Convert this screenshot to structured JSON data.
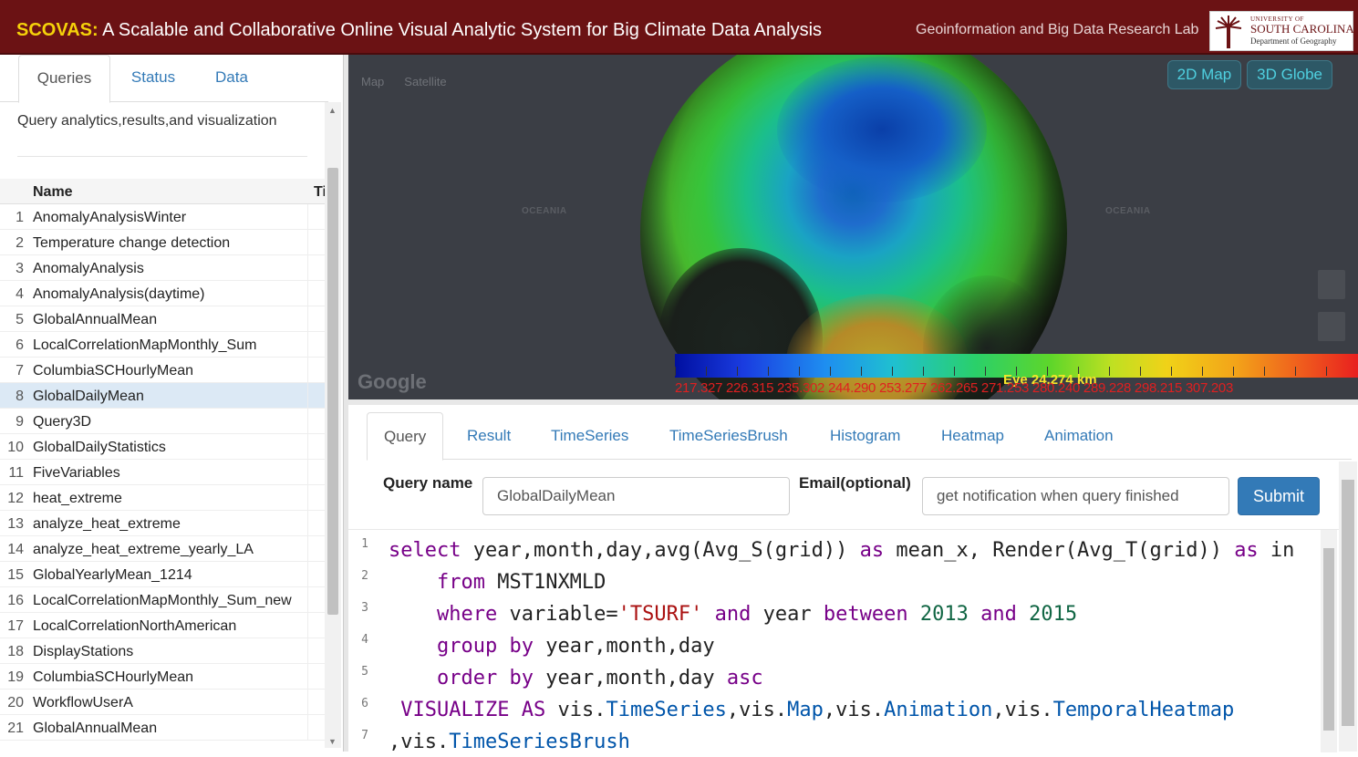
{
  "header": {
    "abbr": "SCOVAS:",
    "title": " A Scalable and Collaborative Online Visual Analytic System for Big Climate Data Analysis",
    "lab": "Geoinformation and Big Data Research Lab",
    "logo": {
      "line1": "UNIVERSITY OF",
      "line2": "SOUTH CAROLINA",
      "line3": "Department of Geography"
    }
  },
  "left_panel": {
    "tabs": [
      {
        "label": "Queries"
      },
      {
        "label": "Status"
      },
      {
        "label": "Data"
      }
    ],
    "description": "Query analytics,results,and visualization",
    "table": {
      "col_name": "Name",
      "col_second": "Ti",
      "rows": [
        {
          "num": "1",
          "name": "AnomalyAnalysisWinter"
        },
        {
          "num": "2",
          "name": "Temperature change detection"
        },
        {
          "num": "3",
          "name": "AnomalyAnalysis"
        },
        {
          "num": "4",
          "name": "AnomalyAnalysis(daytime)"
        },
        {
          "num": "5",
          "name": "GlobalAnnualMean"
        },
        {
          "num": "6",
          "name": "LocalCorrelationMapMonthly_Sum"
        },
        {
          "num": "7",
          "name": "ColumbiaSCHourlyMean"
        },
        {
          "num": "8",
          "name": "GlobalDailyMean"
        },
        {
          "num": "9",
          "name": "Query3D"
        },
        {
          "num": "10",
          "name": "GlobalDailyStatistics"
        },
        {
          "num": "11",
          "name": "FiveVariables"
        },
        {
          "num": "12",
          "name": "heat_extreme"
        },
        {
          "num": "13",
          "name": "analyze_heat_extreme"
        },
        {
          "num": "14",
          "name": "analyze_heat_extreme_yearly_LA"
        },
        {
          "num": "15",
          "name": "GlobalYearlyMean_1214"
        },
        {
          "num": "16",
          "name": "LocalCorrelationMapMonthly_Sum_new"
        },
        {
          "num": "17",
          "name": "LocalCorrelationNorthAmerican"
        },
        {
          "num": "18",
          "name": "DisplayStations"
        },
        {
          "num": "19",
          "name": "ColumbiaSCHourlyMean"
        },
        {
          "num": "20",
          "name": "WorkflowUserA"
        },
        {
          "num": "21",
          "name": "GlobalAnnualMean"
        }
      ]
    }
  },
  "map": {
    "map_type": "Map",
    "satellite": "Satellite",
    "ocean1": "OCEANIA",
    "ocean2": "OCEANIA",
    "view_2d": "2D Map",
    "view_3d": "3D Globe",
    "google": "Google",
    "eye": "Eye  24,274 km",
    "colorbar_labels": "217.327 226.315 235.302 244.290 253.277 262.265 271.253 280.240 289.228 298.215 307.203",
    "colors": {
      "colorbar_low": "#000fa0",
      "colorbar_high": "#e8201f",
      "label_color": "#e01f20"
    }
  },
  "lower_panel": {
    "tabs": [
      {
        "label": "Query"
      },
      {
        "label": "Result"
      },
      {
        "label": "TimeSeries"
      },
      {
        "label": "TimeSeriesBrush"
      },
      {
        "label": "Histogram"
      },
      {
        "label": "Heatmap"
      },
      {
        "label": "Animation"
      }
    ],
    "query_name_label": "Query name",
    "query_name_value": "GlobalDailyMean",
    "email_label": "Email(optional)",
    "email_placeholder": "get notification when query finished",
    "submit": "Submit"
  },
  "editor": {
    "line_numbers": [
      "1",
      "2",
      "3",
      "4",
      "5",
      "6",
      "7"
    ],
    "lines": [
      [
        {
          "t": "select",
          "c": "kw"
        },
        {
          "t": " year,month,day,avg(Avg_S(grid)) ",
          "c": ""
        },
        {
          "t": "as",
          "c": "kw"
        },
        {
          "t": " mean_x, Render(Avg_T(grid)) ",
          "c": ""
        },
        {
          "t": "as",
          "c": "kw"
        },
        {
          "t": " in",
          "c": ""
        }
      ],
      [
        {
          "t": "    ",
          "c": ""
        },
        {
          "t": "from",
          "c": "kw"
        },
        {
          "t": " MST1NXMLD",
          "c": ""
        }
      ],
      [
        {
          "t": "    ",
          "c": ""
        },
        {
          "t": "where",
          "c": "kw"
        },
        {
          "t": " variable=",
          "c": ""
        },
        {
          "t": "'TSURF'",
          "c": "str"
        },
        {
          "t": " ",
          "c": ""
        },
        {
          "t": "and",
          "c": "kw"
        },
        {
          "t": " year ",
          "c": ""
        },
        {
          "t": "between",
          "c": "kw"
        },
        {
          "t": " ",
          "c": ""
        },
        {
          "t": "2013",
          "c": "numv"
        },
        {
          "t": " ",
          "c": ""
        },
        {
          "t": "and",
          "c": "kw"
        },
        {
          "t": " ",
          "c": ""
        },
        {
          "t": "2015",
          "c": "numv"
        }
      ],
      [
        {
          "t": "    ",
          "c": ""
        },
        {
          "t": "group",
          "c": "kw"
        },
        {
          "t": " ",
          "c": ""
        },
        {
          "t": "by",
          "c": "kw"
        },
        {
          "t": " year,month,day",
          "c": ""
        }
      ],
      [
        {
          "t": "    ",
          "c": ""
        },
        {
          "t": "order",
          "c": "kw"
        },
        {
          "t": " ",
          "c": ""
        },
        {
          "t": "by",
          "c": "kw"
        },
        {
          "t": " year,month,day ",
          "c": ""
        },
        {
          "t": "asc",
          "c": "kw"
        }
      ],
      [
        {
          "t": " ",
          "c": ""
        },
        {
          "t": "VISUALIZE",
          "c": "kw"
        },
        {
          "t": " ",
          "c": ""
        },
        {
          "t": "AS",
          "c": "kw"
        },
        {
          "t": " vis.",
          "c": ""
        },
        {
          "t": "TimeSeries",
          "c": "prop"
        },
        {
          "t": ",vis.",
          "c": ""
        },
        {
          "t": "Map",
          "c": "prop"
        },
        {
          "t": ",vis.",
          "c": ""
        },
        {
          "t": "Animation",
          "c": "prop"
        },
        {
          "t": ",vis.",
          "c": ""
        },
        {
          "t": "TemporalHeatmap",
          "c": "prop"
        }
      ],
      [
        {
          "t": ",vis.",
          "c": ""
        },
        {
          "t": "TimeSeriesBrush",
          "c": "prop"
        }
      ]
    ]
  }
}
